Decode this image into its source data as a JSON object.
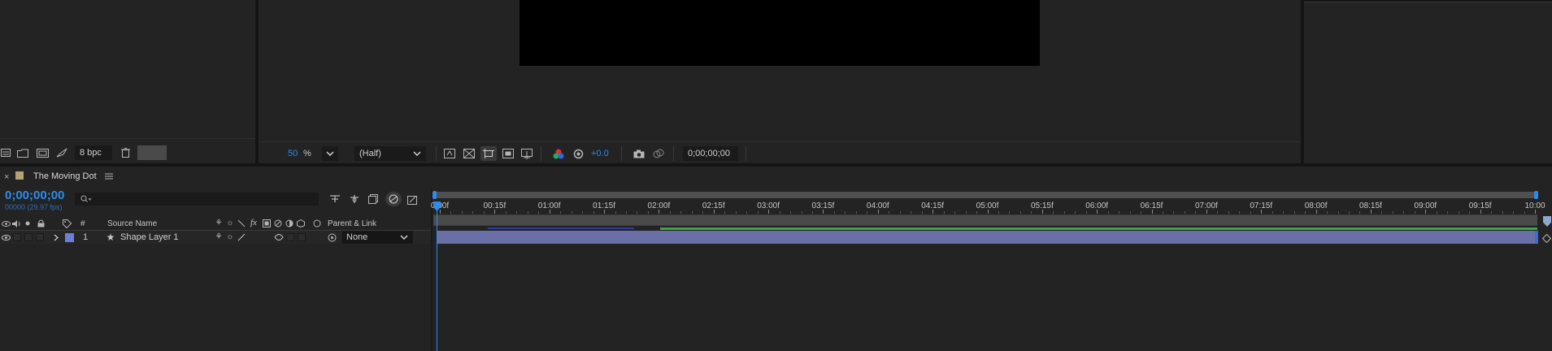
{
  "project_panel": {
    "bpc_label": "8 bpc",
    "icons": [
      "interpret-footage-icon",
      "new-folder-icon",
      "new-composition-icon",
      "render-icon",
      "trash-icon"
    ]
  },
  "viewer_toolbar": {
    "zoom_value": "50",
    "zoom_unit": "%",
    "resolution": "(Half)",
    "exposure": "+0.0",
    "timecode": "0;00;00;00"
  },
  "timeline": {
    "comp_name": "The Moving Dot",
    "current_time": "0;00;00;00",
    "frame_info": "00000 (29.97 fps)",
    "search_placeholder": "",
    "columns": {
      "number": "#",
      "source_name": "Source Name",
      "parent_link": "Parent & Link"
    },
    "layers": [
      {
        "number": "1",
        "name": "Shape Layer 1",
        "parent": "None",
        "label_color": "#6c7fd8"
      }
    ],
    "ruler_labels": [
      "0:00f",
      "00:15f",
      "01:00f",
      "01:15f",
      "02:00f",
      "02:15f",
      "03:00f",
      "03:15f",
      "04:00f",
      "04:15f",
      "05:00f",
      "05:15f",
      "06:00f",
      "06:15f",
      "07:00f",
      "07:15f",
      "08:00f",
      "08:15f",
      "09:00f",
      "09:15f",
      "10:00"
    ]
  },
  "colors": {
    "accent_blue": "#2d8ceb",
    "layer_bar": "#6a6fa8",
    "work_area_green": "#3aa645"
  }
}
